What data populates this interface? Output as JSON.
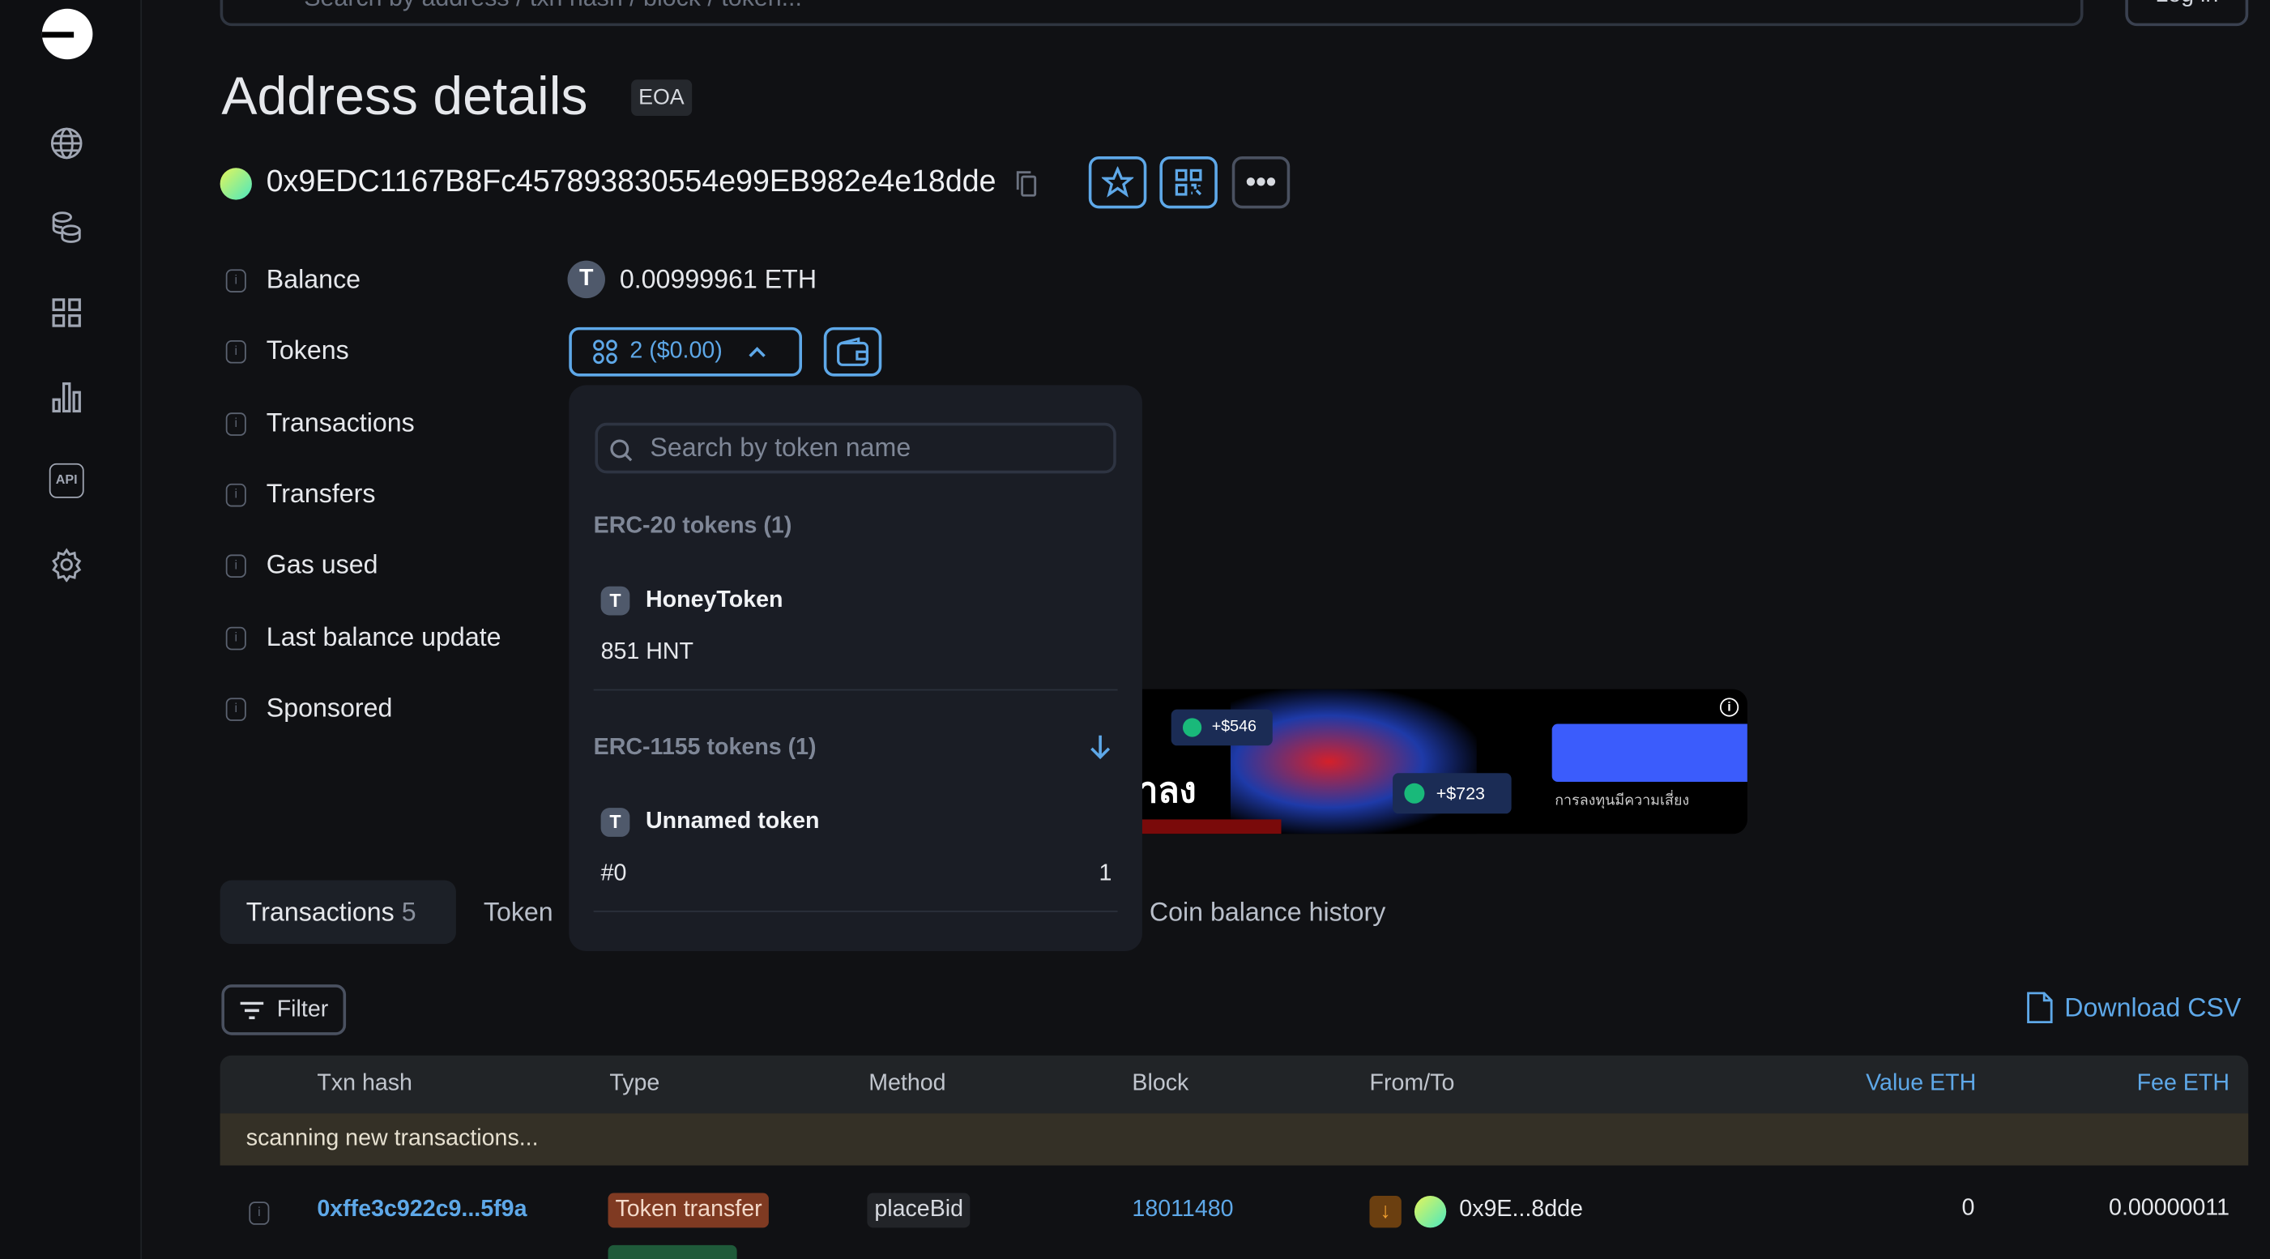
{
  "search": {
    "placeholder": "Search by address / txn hash / block / token..."
  },
  "header": {
    "login_label": "Log in"
  },
  "sidebar": {
    "items": [
      {
        "icon": "globe-icon"
      },
      {
        "icon": "coins-icon"
      },
      {
        "icon": "apps-grid-icon"
      },
      {
        "icon": "bar-chart-icon"
      },
      {
        "icon": "api-icon",
        "label": "API"
      },
      {
        "icon": "gear-icon"
      }
    ]
  },
  "page": {
    "title": "Address details",
    "badge": "EOA",
    "address": "0x9EDC1167B8Fc457893830554e99EB982e4e18dde"
  },
  "details": {
    "labels": [
      "Balance",
      "Tokens",
      "Transactions",
      "Transfers",
      "Gas used",
      "Last balance update",
      "Sponsored"
    ],
    "balance_icon": "T",
    "balance": "0.00999961 ETH",
    "tokens_button": "2 ($0.00)"
  },
  "token_dropdown": {
    "search_placeholder": "Search by token name",
    "erc20_header": "ERC-20 tokens (1)",
    "erc20": [
      {
        "icon": "T",
        "name": "HoneyToken",
        "amount": "851 HNT"
      }
    ],
    "erc1155_header": "ERC-1155 tokens (1)",
    "erc1155": [
      {
        "icon": "T",
        "name": "Unnamed token",
        "id": "#0",
        "amount": "1"
      }
    ]
  },
  "ad": {
    "headline": "ขาลง",
    "chip1": "+$546",
    "chip2": "+$723",
    "disclaimer": "การลงทุนมีความเสี่ยง"
  },
  "tabs": [
    {
      "label": "Transactions",
      "count": "5"
    },
    {
      "label": "Token"
    },
    {
      "label": "Coin balance history"
    }
  ],
  "toolbar": {
    "filter_label": "Filter",
    "download_label": "Download CSV"
  },
  "table": {
    "headers": [
      "Txn hash",
      "Type",
      "Method",
      "Block",
      "From/To",
      "Value ETH",
      "Fee ETH"
    ],
    "scanning": "scanning new transactions...",
    "rows": [
      {
        "hash": "0xffe3c922c9...5f9a",
        "type": "Token transfer",
        "method": "placeBid",
        "block": "18011480",
        "from_to": "0x9E...8dde",
        "value": "0",
        "fee": "0.00000011"
      }
    ]
  },
  "colors": {
    "accent": "#5ea8e8",
    "background": "#101114",
    "token_transfer": "#7f3a22",
    "scan_row": "#343026"
  }
}
